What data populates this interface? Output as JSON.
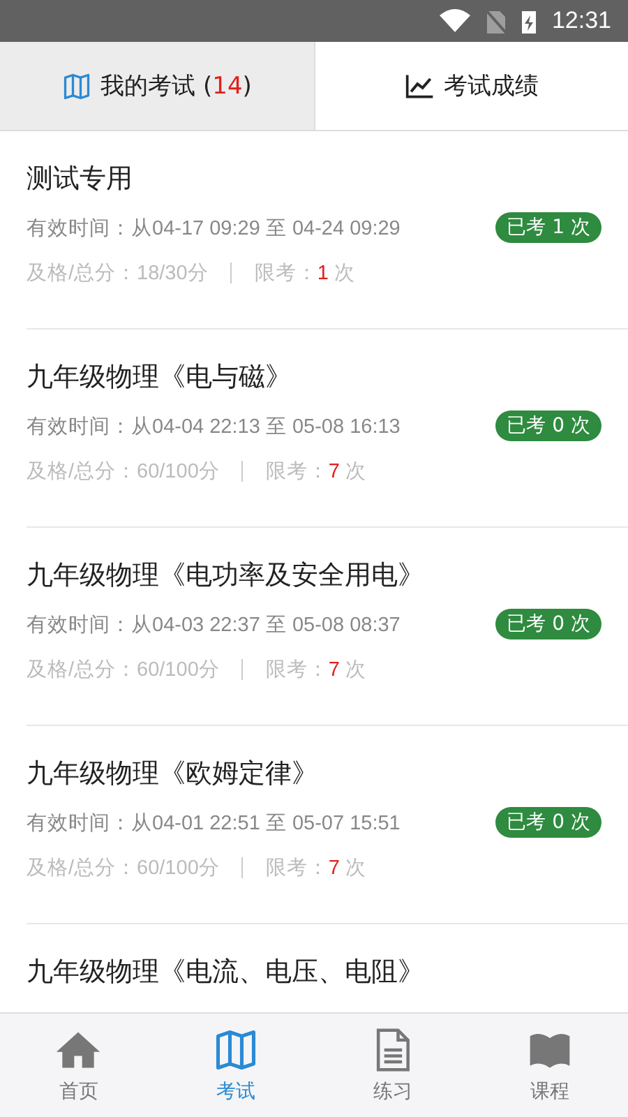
{
  "status_bar": {
    "time": "12:31"
  },
  "tabs": [
    {
      "label": "我的考试 (",
      "count": "14",
      "suffix": ")",
      "kind": "map",
      "selected": true
    },
    {
      "label": "考试成绩",
      "kind": "chart",
      "selected": false
    }
  ],
  "exams": [
    {
      "title": "测试专用",
      "validity": "有效时间：从04-17 09:29 至 04-24 09:29",
      "badge": "已考 1 次",
      "score": "及格/总分：18/30分",
      "limit_label": "限考：",
      "limit": "1",
      "limit_unit": "次"
    },
    {
      "title": "九年级物理《电与磁》",
      "validity": "有效时间：从04-04 22:13 至 05-08 16:13",
      "badge": "已考 0 次",
      "score": "及格/总分：60/100分",
      "limit_label": "限考：",
      "limit": "7",
      "limit_unit": "次"
    },
    {
      "title": "九年级物理《电功率及安全用电》",
      "validity": "有效时间：从04-03 22:37 至 05-08 08:37",
      "badge": "已考 0 次",
      "score": "及格/总分：60/100分",
      "limit_label": "限考：",
      "limit": "7",
      "limit_unit": "次"
    },
    {
      "title": "九年级物理《欧姆定律》",
      "validity": "有效时间：从04-01 22:51 至 05-07 15:51",
      "badge": "已考 0 次",
      "score": "及格/总分：60/100分",
      "limit_label": "限考：",
      "limit": "7",
      "limit_unit": "次"
    },
    {
      "title": "九年级物理《电流、电压、电阻》"
    }
  ],
  "bottom_nav": [
    {
      "label": "首页",
      "kind": "home",
      "selected": false
    },
    {
      "label": "考试",
      "kind": "map",
      "selected": true
    },
    {
      "label": "练习",
      "kind": "doc",
      "selected": false
    },
    {
      "label": "课程",
      "kind": "book",
      "selected": false
    }
  ]
}
